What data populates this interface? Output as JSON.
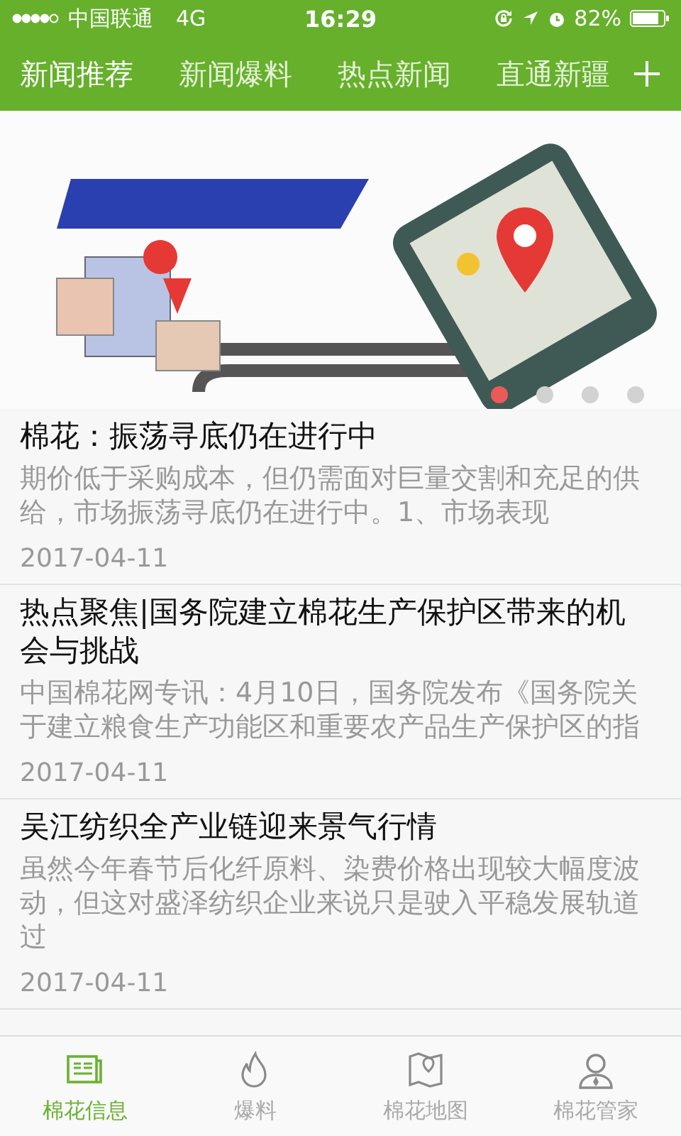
{
  "status_bar": {
    "carrier": "中国联通",
    "network": "4G",
    "time": "16:29",
    "battery": "82%"
  },
  "channel_tabs": [
    {
      "label": "新闻推荐",
      "selected": true
    },
    {
      "label": "新闻爆料",
      "selected": false
    },
    {
      "label": "热点新闻",
      "selected": false
    },
    {
      "label": "直通新疆",
      "selected": false
    }
  ],
  "banner": {
    "pages": [
      {
        "selected": true
      },
      {
        "selected": false
      },
      {
        "selected": false
      },
      {
        "selected": false
      }
    ]
  },
  "articles": [
    {
      "title": "棉花：振荡寻底仍在进行中",
      "summary": "期价低于采购成本，但仍需面对巨量交割和充足的供给，市场振荡寻底仍在进行中。1、市场表现",
      "date": "2017-04-11"
    },
    {
      "title": "热点聚焦|国务院建立棉花生产保护区带来的机会与挑战",
      "summary": "中国棉花网专讯：4月10日，国务院发布《国务院关于建立粮食生产功能区和重要农产品生产保护区的指",
      "date": "2017-04-11"
    },
    {
      "title": "吴江纺织全产业链迎来景气行情",
      "summary": "虽然今年春节后化纤原料、染费价格出现较大幅度波动，但这对盛泽纺织企业来说只是驶入平稳发展轨道过",
      "date": "2017-04-11"
    }
  ],
  "bottom_tabs": [
    {
      "label": "棉花信息",
      "selected": true
    },
    {
      "label": "爆料",
      "selected": false
    },
    {
      "label": "棉花地图",
      "selected": false
    },
    {
      "label": "棉花管家",
      "selected": false
    }
  ]
}
